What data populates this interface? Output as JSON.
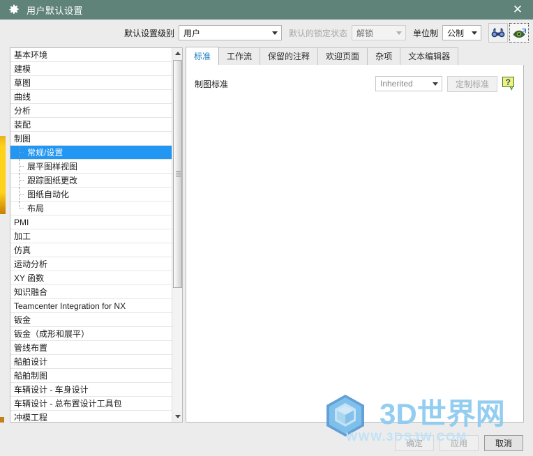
{
  "window": {
    "title": "用户默认设置",
    "gear_icon": "gear-icon",
    "close_icon": "close-icon",
    "title_bg": "#5f8279"
  },
  "toolbar": {
    "level_label": "默认设置级别",
    "level_value": "用户",
    "lock_label": "默认的锁定状态",
    "lock_value": "解锁",
    "units_label": "单位制",
    "units_value": "公制",
    "find_icon": "binoculars-icon",
    "jump_icon": "eye-arrow-icon"
  },
  "tree": {
    "items": [
      {
        "label": "基本环境",
        "level": 0,
        "selected": false
      },
      {
        "label": "建模",
        "level": 0,
        "selected": false
      },
      {
        "label": "草图",
        "level": 0,
        "selected": false
      },
      {
        "label": "曲线",
        "level": 0,
        "selected": false
      },
      {
        "label": "分析",
        "level": 0,
        "selected": false
      },
      {
        "label": "装配",
        "level": 0,
        "selected": false
      },
      {
        "label": "制图",
        "level": 0,
        "selected": false
      },
      {
        "label": "常规/设置",
        "level": 1,
        "selected": true
      },
      {
        "label": "展平图样视图",
        "level": 1,
        "selected": false
      },
      {
        "label": "跟踪图纸更改",
        "level": 1,
        "selected": false
      },
      {
        "label": "图纸自动化",
        "level": 1,
        "selected": false
      },
      {
        "label": "布局",
        "level": 1,
        "selected": false,
        "last": true
      },
      {
        "label": "PMI",
        "level": 0,
        "selected": false
      },
      {
        "label": "加工",
        "level": 0,
        "selected": false
      },
      {
        "label": "仿真",
        "level": 0,
        "selected": false
      },
      {
        "label": "运动分析",
        "level": 0,
        "selected": false
      },
      {
        "label": "XY 函数",
        "level": 0,
        "selected": false
      },
      {
        "label": "知识融合",
        "level": 0,
        "selected": false
      },
      {
        "label": "Teamcenter Integration for NX",
        "level": 0,
        "selected": false
      },
      {
        "label": "钣金",
        "level": 0,
        "selected": false
      },
      {
        "label": "钣金（成形和展平）",
        "level": 0,
        "selected": false
      },
      {
        "label": "管线布置",
        "level": 0,
        "selected": false
      },
      {
        "label": "船舶设计",
        "level": 0,
        "selected": false
      },
      {
        "label": "船舶制图",
        "level": 0,
        "selected": false
      },
      {
        "label": "车辆设计 - 车身设计",
        "level": 0,
        "selected": false
      },
      {
        "label": "车辆设计 - 总布置设计工具包",
        "level": 0,
        "selected": false
      },
      {
        "label": "冲模工程",
        "level": 0,
        "selected": false
      }
    ],
    "selection_color": "#2196f3",
    "scroll_up_icon": "scroll-up-arrow-icon",
    "scroll_down_icon": "scroll-down-arrow-icon"
  },
  "tabs": [
    {
      "label": "标准",
      "active": true
    },
    {
      "label": "工作流",
      "active": false
    },
    {
      "label": "保留的注释",
      "active": false
    },
    {
      "label": "欢迎页面",
      "active": false
    },
    {
      "label": "杂项",
      "active": false
    },
    {
      "label": "文本编辑器",
      "active": false
    }
  ],
  "content": {
    "standard_label": "制图标准",
    "standard_value": "Inherited",
    "customize_button": "定制标准",
    "help_icon": "help-question-icon"
  },
  "footer": {
    "ok": "确定",
    "apply": "应用",
    "cancel": "取消"
  },
  "watermark": {
    "brand": "3D世界网",
    "url": "WWW.3DSJW.COM",
    "logo_icon": "cube-hexagon-logo-icon"
  }
}
